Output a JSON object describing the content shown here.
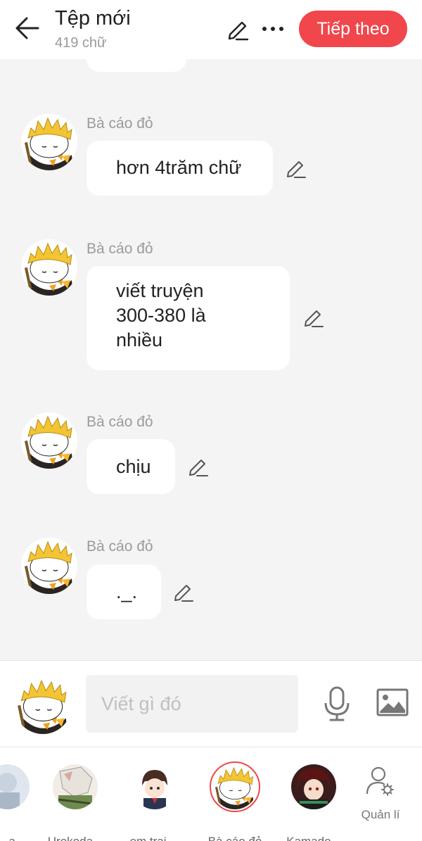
{
  "header": {
    "title": "Tệp mới",
    "word_count": "419 chữ",
    "next_label": "Tiếp theo",
    "accent_color": "#f0464c"
  },
  "messages": [
    {
      "sender": "Bà cáo đỏ",
      "text": "hơn 4trăm chữ"
    },
    {
      "sender": "Bà cáo đỏ",
      "text_lines": [
        "viết truyện",
        "300-380 là",
        "nhiều"
      ]
    },
    {
      "sender": "Bà cáo đỏ",
      "text": "chịu"
    },
    {
      "sender": "Bà cáo đỏ",
      "text": "._."
    }
  ],
  "composer": {
    "placeholder": "Viết gì đó",
    "icons": [
      "microphone-icon",
      "image-icon"
    ]
  },
  "characters": [
    {
      "name": "a...",
      "partial": true
    },
    {
      "name": "Urokoda..."
    },
    {
      "name": "em trai ..."
    },
    {
      "name": "Bà cáo đỏ",
      "selected": true
    },
    {
      "name": "Kamado..."
    }
  ],
  "manage": {
    "label": "Quản lí"
  }
}
